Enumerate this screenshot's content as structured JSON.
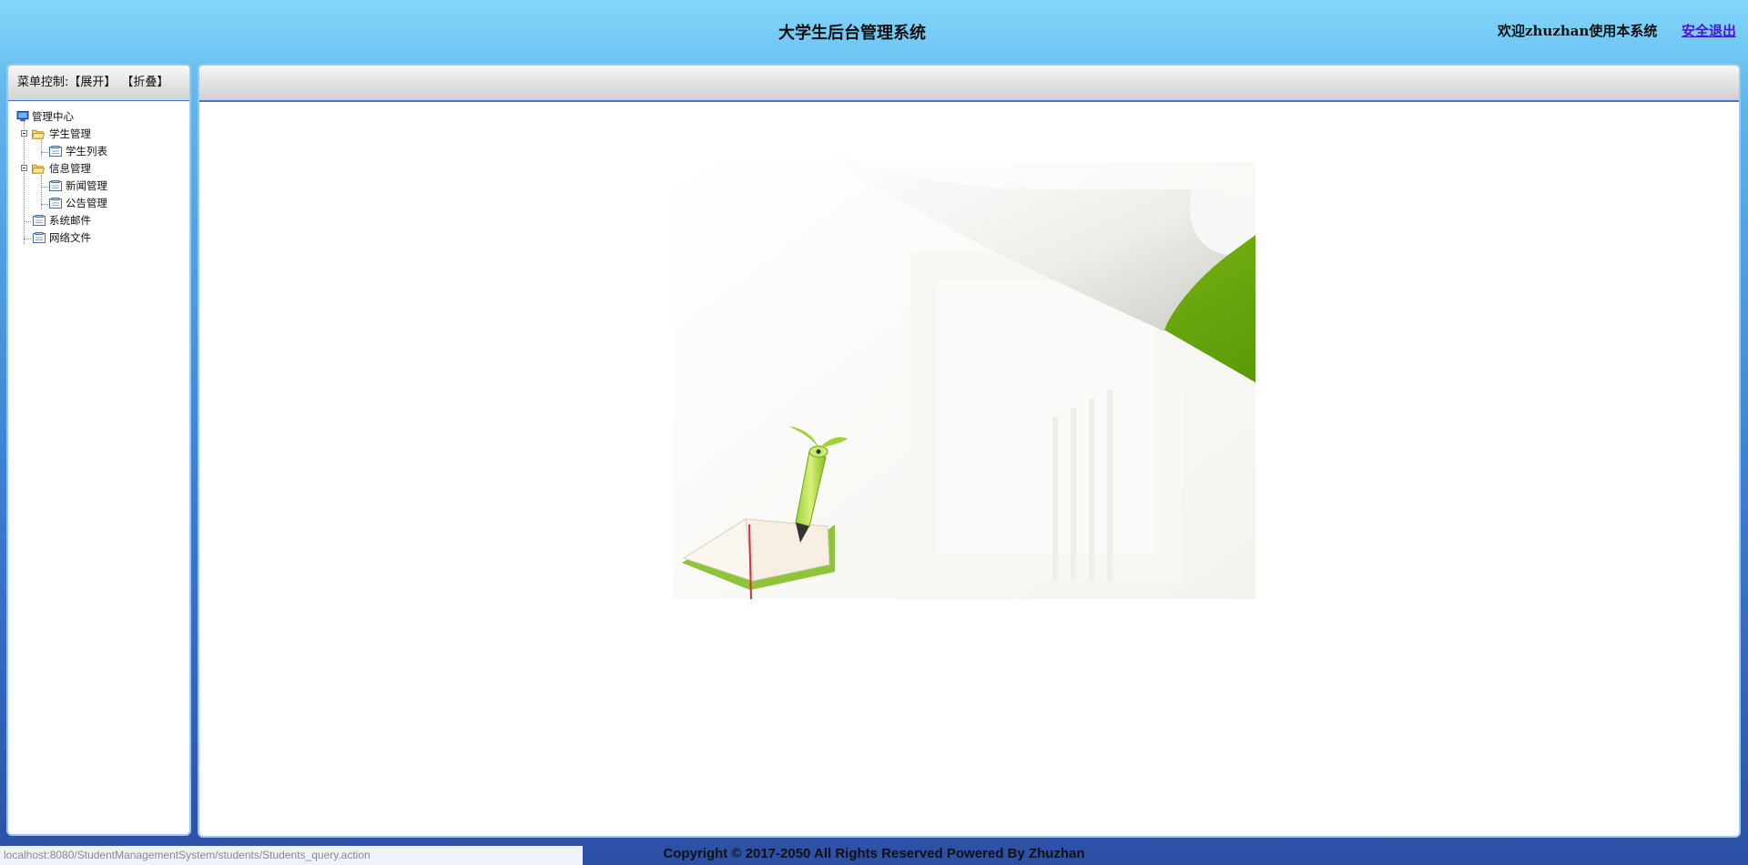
{
  "header": {
    "title": "大学生后台管理系统",
    "welcome_text": "欢迎zhuzhan使用本系统",
    "logout_label": "安全退出"
  },
  "left_panel": {
    "menu_control_label": "菜单控制:",
    "expand_label": "【展开】",
    "collapse_label": "【折叠】",
    "tree": {
      "root": "管理中心",
      "student_folder": "学生管理",
      "student_list": "学生列表",
      "info_folder": "信息管理",
      "news": "新闻管理",
      "notice": "公告管理",
      "mail": "系统邮件",
      "files": "网络文件"
    }
  },
  "footer": {
    "status_url": "localhost:8080/StudentManagementSystem/students/Students_query.action",
    "copyright": "Copyright © 2017-2050 All Rights Reserved Powered By Zhuzhan"
  },
  "colors": {
    "header_bg": "#7fd3f7",
    "body_bg_bottom": "#2c4fa4",
    "panel_border": "#9ec8ea",
    "header_divider": "#3d78c9",
    "accent_green": "#6aa90c"
  },
  "icons": {
    "root": "computer-icon",
    "folder": "folder-open-icon",
    "page": "page-icon"
  }
}
